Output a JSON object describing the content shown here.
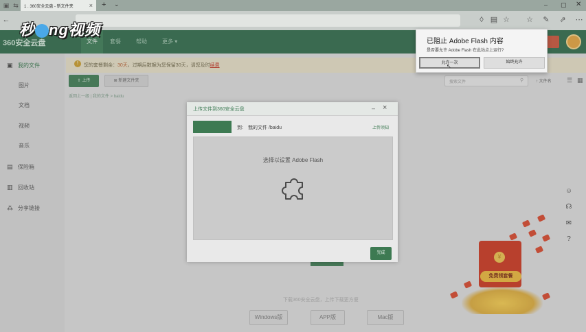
{
  "browser": {
    "tab_title": "1 . 360安全云盘 - 新文件夹",
    "tab_close": "×",
    "new_tab": "+",
    "tab_menu": "⌄"
  },
  "watermark": {
    "text_left": "秒",
    "text_right": "ng视频"
  },
  "app": {
    "logo": "360安全云盘",
    "nav": [
      "文件",
      "套餐",
      "帮助",
      "更多 ▾"
    ]
  },
  "sidebar": {
    "items": [
      {
        "label": "我的文件",
        "icon": "folder-icon"
      },
      {
        "label": "图片"
      },
      {
        "label": "文档"
      },
      {
        "label": "视频"
      },
      {
        "label": "音乐"
      },
      {
        "label": "保险箱",
        "icon": "safe-icon"
      },
      {
        "label": "回收站",
        "icon": "trash-icon"
      },
      {
        "label": "分享链接",
        "icon": "share-icon"
      }
    ]
  },
  "main": {
    "notice_prefix": "您的套餐剩余：",
    "notice_days": "30天",
    "notice_mid": "，过期后数据为您保留30天，请您及时",
    "notice_link": "续费",
    "upload_button": "上传",
    "new_folder_button": "新建文件夹",
    "breadcrumb": "返回上一级 | 我的文件 > baidu",
    "search_placeholder": "搜索文件",
    "sort_label": "↑ 文件名",
    "bottom_hint": "下载360安全云盘，上传下载更方便",
    "download_buttons": [
      "Windows版",
      "APP版",
      "Mac版"
    ],
    "envelope_badge": "免费领套餐",
    "envelope_coin": "¥"
  },
  "dialog": {
    "title": "上传文件到360安全云盘",
    "minimize": "–",
    "close": "×",
    "to_label": "到:",
    "path": "我的文件 /baidu",
    "notice_link": "上传须知",
    "flash_text": "选择以设置 Adobe Flash",
    "done_button": "完成"
  },
  "flash_popup": {
    "title": "已阻止 Adobe Flash 内容",
    "subtitle": "是否要允许 Adobe Flash 在此站点上运行?",
    "allow_once": "允许一次",
    "always_allow": "始终允许"
  },
  "colors": {
    "accent": "#3d7a52",
    "header": "#2f6a4a",
    "warning": "#c03a2a"
  }
}
